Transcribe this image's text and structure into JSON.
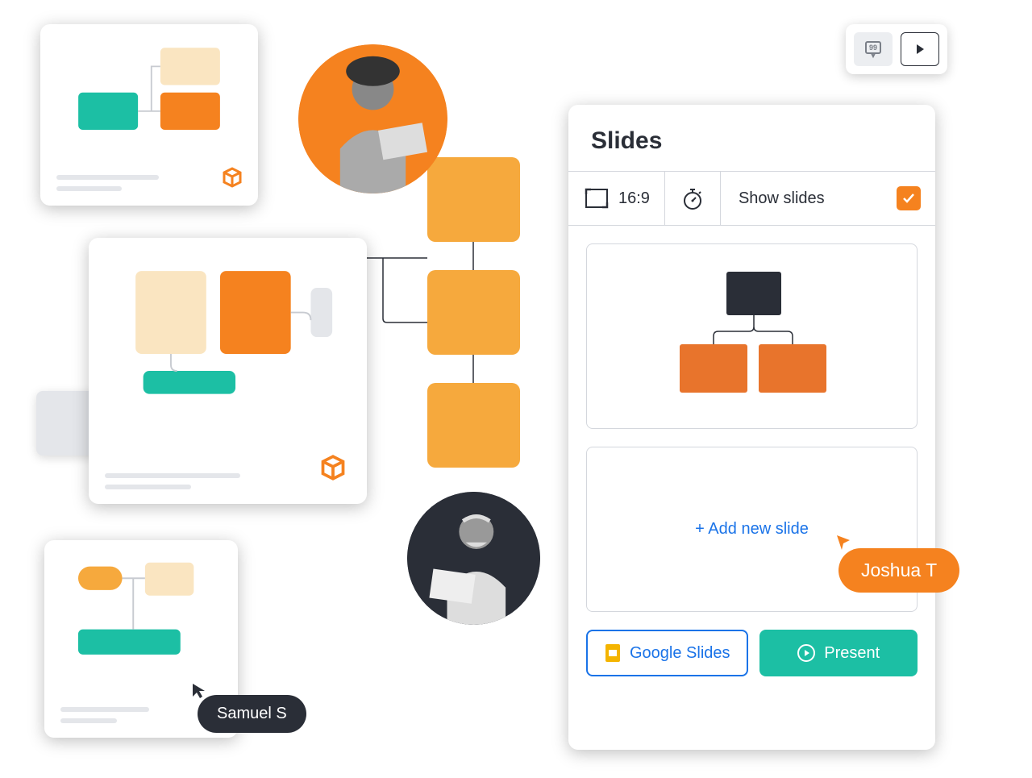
{
  "panel": {
    "title": "Slides",
    "aspect_ratio": "16:9",
    "show_slides_label": "Show slides",
    "show_slides_checked": true,
    "add_new_slide_label": "+  Add new slide",
    "google_slides_label": "Google Slides",
    "present_label": "Present"
  },
  "cursors": {
    "user1": "Samuel S",
    "user2": "Joshua T"
  },
  "colors": {
    "orange": "#f5821f",
    "orange_light": "#f6a93d",
    "teal": "#1cbfa4",
    "cream": "#fae5c1",
    "dark": "#2a2e37",
    "blue": "#1a73e8"
  }
}
